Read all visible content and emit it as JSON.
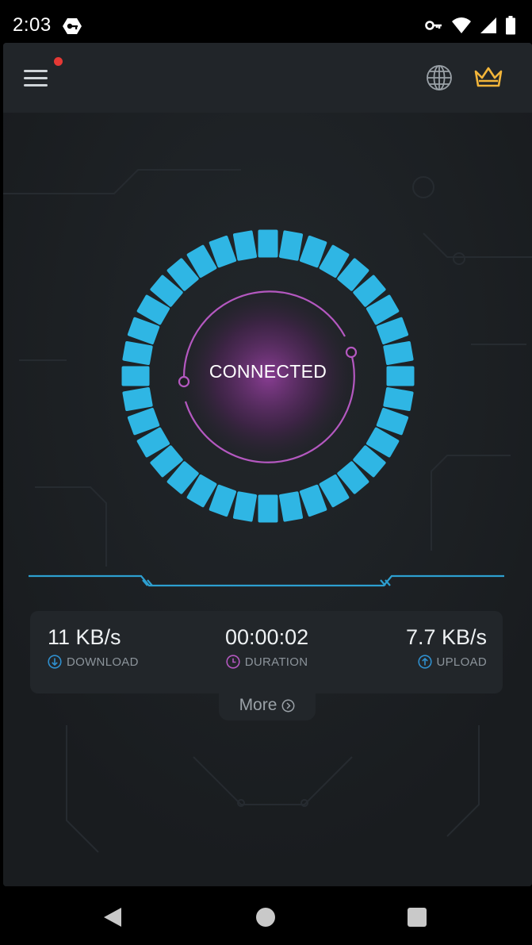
{
  "status_bar": {
    "time": "2:03",
    "icons": [
      "vpn-badge-icon",
      "key-icon",
      "wifi-icon",
      "signal-icon",
      "battery-icon"
    ]
  },
  "toolbar": {
    "menu_icon": "hamburger-menu-icon",
    "notification": true,
    "globe_icon": "globe-icon",
    "premium_icon": "crown-icon"
  },
  "dial": {
    "status": "CONNECTED",
    "segment_color": "#2fb6e4",
    "ring_color": "#b458c0"
  },
  "stats": {
    "download": {
      "value": "11 KB/s",
      "label": "DOWNLOAD",
      "icon": "arrow-down-circle-icon",
      "color": "#2f8fce"
    },
    "duration": {
      "value": "00:00:02",
      "label": "DURATION",
      "icon": "clock-icon",
      "color": "#b458c0"
    },
    "upload": {
      "value": "7.7 KB/s",
      "label": "UPLOAD",
      "icon": "arrow-up-circle-icon",
      "color": "#2f8fce"
    }
  },
  "more": {
    "label": "More",
    "icon": "chevron-right-circle-icon"
  },
  "nav": {
    "back": "back-triangle-icon",
    "home": "home-circle-icon",
    "recents": "recents-square-icon"
  }
}
